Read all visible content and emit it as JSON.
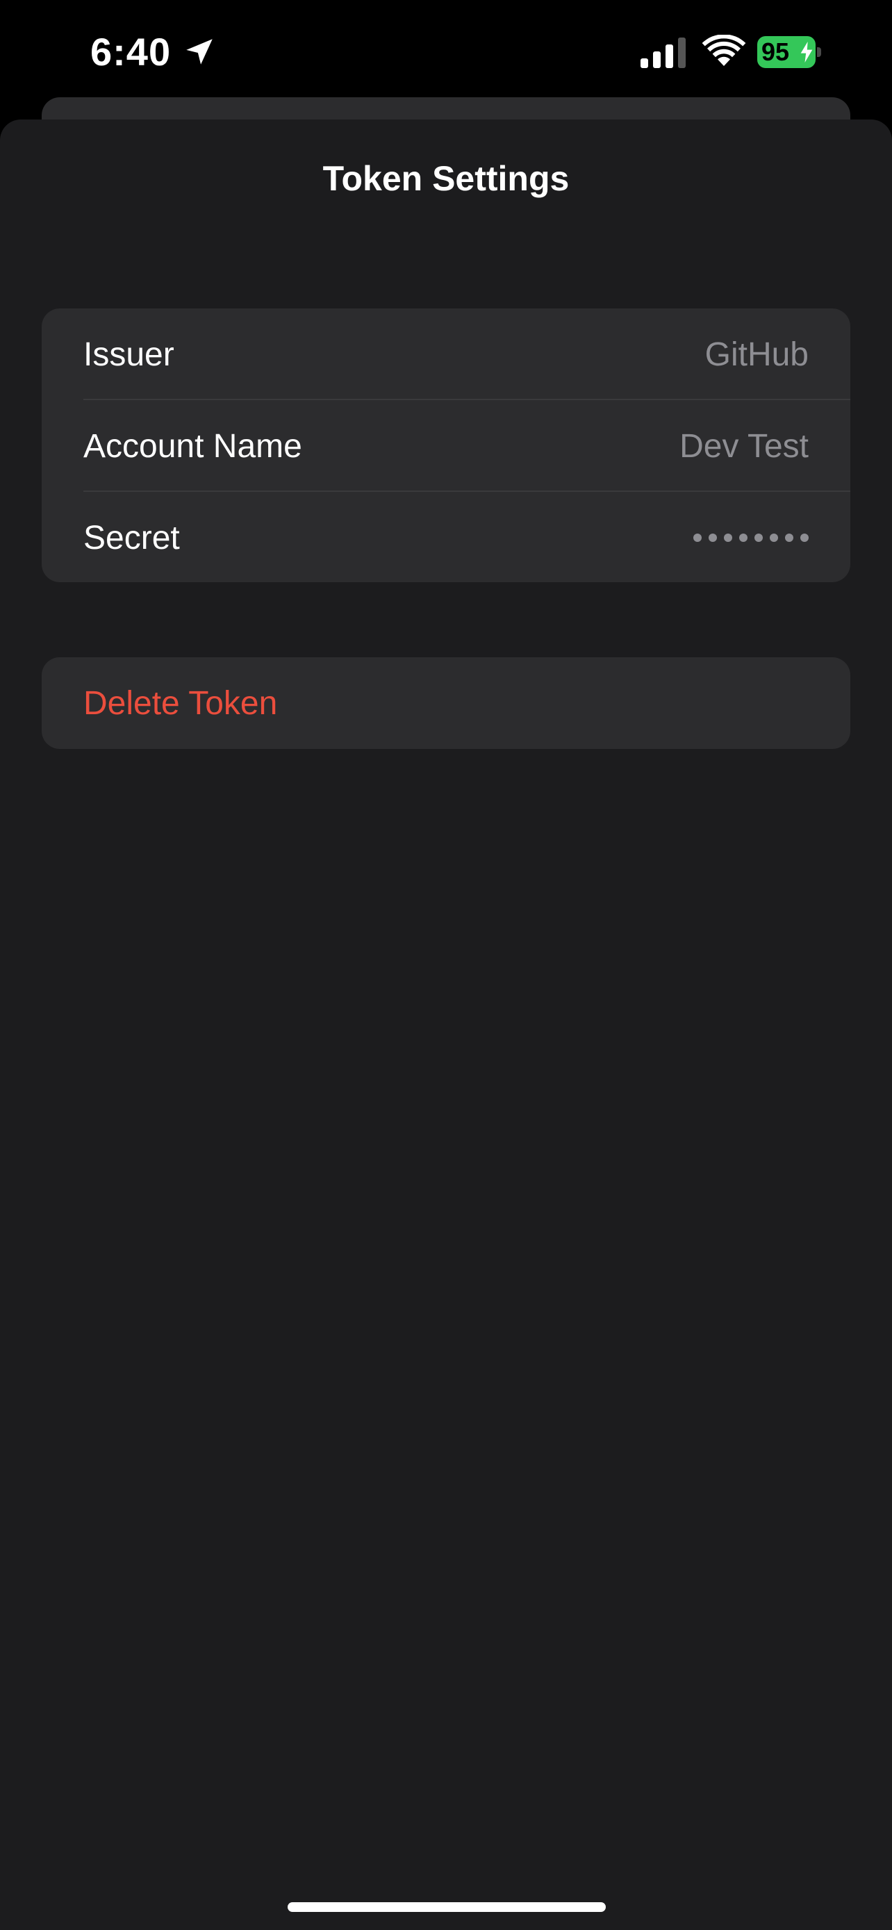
{
  "status_bar": {
    "time": "6:40",
    "battery_level": "95",
    "battery_color": "#34c759"
  },
  "sheet": {
    "title": "Token Settings"
  },
  "fields": [
    {
      "label": "Issuer",
      "value": "GitHub"
    },
    {
      "label": "Account Name",
      "value": "Dev Test"
    },
    {
      "label": "Secret",
      "value_masked": true
    }
  ],
  "actions": {
    "delete_label": "Delete Token",
    "delete_color": "#eb4e3d"
  },
  "icons": [
    "location-arrow-icon",
    "cellular-signal-icon",
    "wifi-icon",
    "battery-charging-icon"
  ]
}
